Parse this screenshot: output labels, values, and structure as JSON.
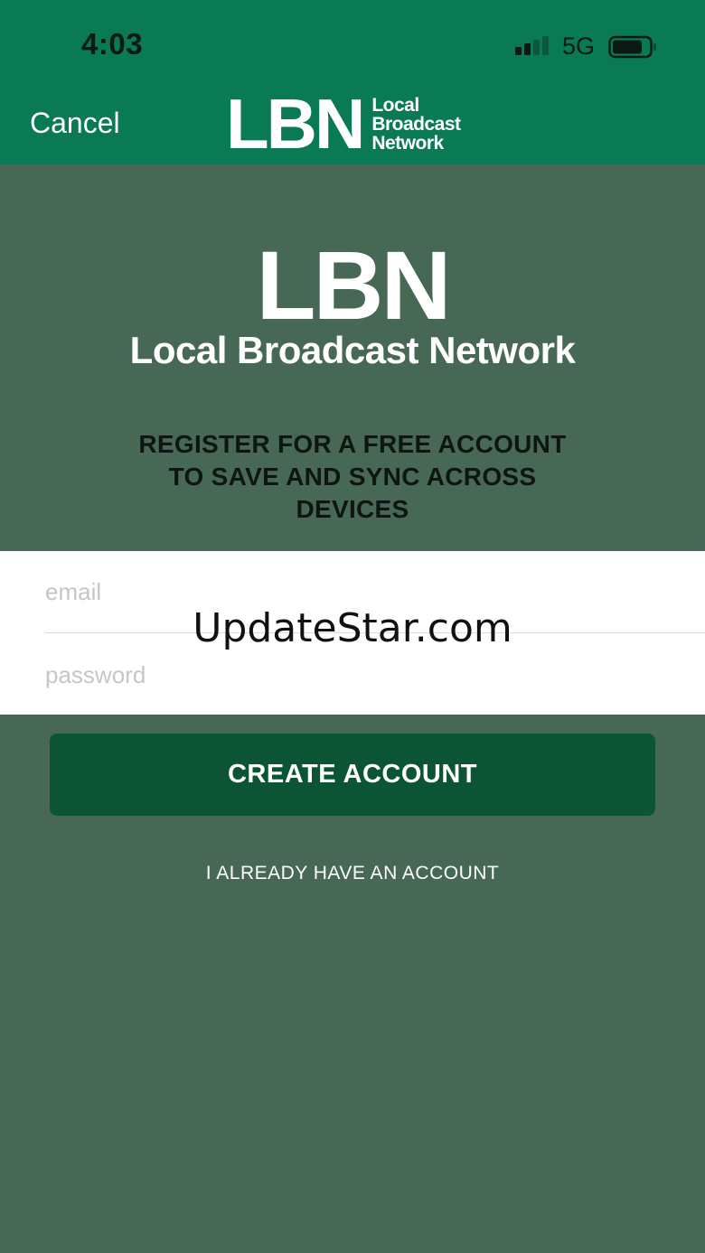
{
  "status_bar": {
    "time": "4:03",
    "network": "5G",
    "icons": [
      "signal-icon",
      "battery-icon"
    ]
  },
  "nav": {
    "cancel_label": "Cancel",
    "logo_main": "LBN",
    "logo_line1": "Local",
    "logo_line2": "Broadcast",
    "logo_line3": "Network"
  },
  "hero": {
    "logo_main": "LBN",
    "logo_sub": "Local Broadcast Network",
    "tagline_line1": "REGISTER FOR A FREE ACCOUNT",
    "tagline_line2": "TO SAVE AND SYNC ACROSS",
    "tagline_line3": "DEVICES"
  },
  "form": {
    "email_placeholder": "email",
    "password_placeholder": "password",
    "create_label": "CREATE ACCOUNT",
    "have_account_label": "I ALREADY HAVE AN ACCOUNT"
  },
  "watermark": "UpdateStar.com",
  "colors": {
    "header_green": "#0a7a55",
    "background": "#466855",
    "button_green": "#0b5535"
  }
}
